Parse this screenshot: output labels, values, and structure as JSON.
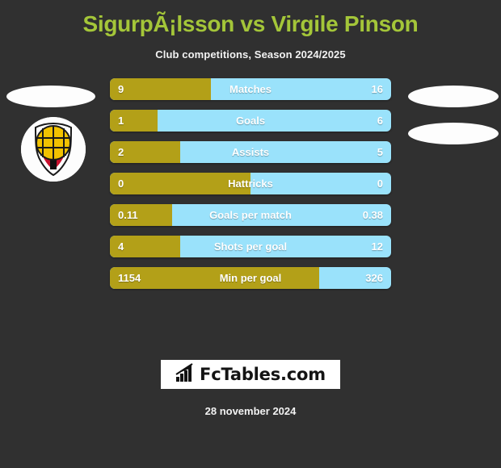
{
  "header": {
    "title": "SigurpÃ¡lsson vs Virgile Pinson",
    "subtitle": "Club competitions, Season 2024/2025"
  },
  "colors": {
    "background": "#303030",
    "title_green": "#A4C639",
    "bar_left_gold": "#B3A018",
    "bar_right_cyan": "#9AE2FB",
    "text_white": "#FFFFFF",
    "logo_background": "#FFFFFF"
  },
  "left_player": {
    "photo_placeholder": "empty-avatar",
    "club_badge": "shield-crest-yellow-ball"
  },
  "right_player": {
    "photo_placeholder_1": "empty-avatar",
    "photo_placeholder_2": "empty-avatar"
  },
  "chart_data": {
    "type": "bar",
    "title": "SigurpÃ¡lsson vs Virgile Pinson",
    "subtitle": "Club competitions, Season 2024/2025",
    "orientation": "horizontal-diverging",
    "series": [
      {
        "name": "SigurpÃ¡lsson",
        "color": "#B3A018",
        "align": "left"
      },
      {
        "name": "Virgile Pinson",
        "color": "#9AE2FB",
        "align": "right"
      }
    ],
    "categories": [
      "Matches",
      "Goals",
      "Assists",
      "Hattricks",
      "Goals per match",
      "Shots per goal",
      "Min per goal"
    ],
    "left_values": [
      "9",
      "1",
      "2",
      "0",
      "0.11",
      "4",
      "1154"
    ],
    "right_values": [
      "16",
      "6",
      "5",
      "0",
      "0.38",
      "12",
      "326"
    ],
    "left_fill_percent": [
      36,
      17,
      25,
      50,
      22,
      25,
      74.4
    ]
  },
  "rows": [
    {
      "label": "Matches",
      "left": "9",
      "right": "16",
      "fill": 36
    },
    {
      "label": "Goals",
      "left": "1",
      "right": "6",
      "fill": 17
    },
    {
      "label": "Assists",
      "left": "2",
      "right": "5",
      "fill": 25
    },
    {
      "label": "Hattricks",
      "left": "0",
      "right": "0",
      "fill": 50
    },
    {
      "label": "Goals per match",
      "left": "0.11",
      "right": "0.38",
      "fill": 22
    },
    {
      "label": "Shots per goal",
      "left": "4",
      "right": "12",
      "fill": 25
    },
    {
      "label": "Min per goal",
      "left": "1154",
      "right": "326",
      "fill": 74.4
    }
  ],
  "footer": {
    "logo_text": "FcTables.com",
    "logo_icon": "bar-chart-trending-up-icon",
    "date": "28 november 2024"
  }
}
